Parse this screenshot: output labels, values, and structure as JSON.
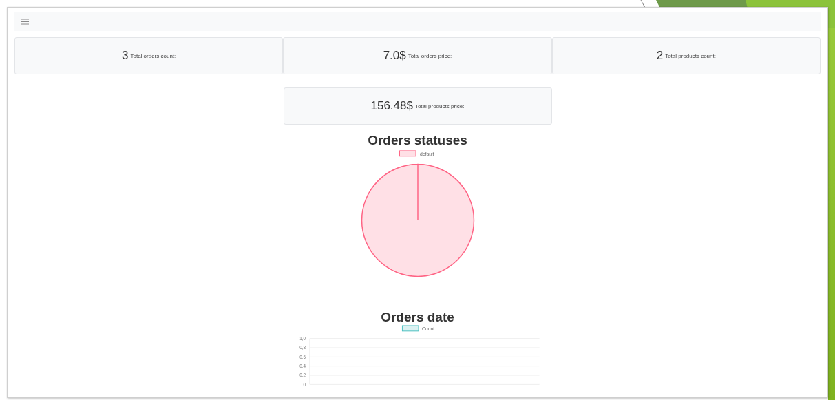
{
  "stats": [
    {
      "value": "3",
      "label": "Total orders count:"
    },
    {
      "value": "7.0$",
      "label": "Total orders price:"
    },
    {
      "value": "2",
      "label": "Total products count:"
    },
    {
      "value": "156.48$",
      "label": "Total products price:"
    }
  ],
  "orders_statuses": {
    "title": "Orders statuses",
    "chart_data": {
      "type": "pie",
      "categories": [
        "default"
      ],
      "values": [
        100
      ]
    }
  },
  "orders_date": {
    "title": "Orders date",
    "chart_data": {
      "type": "bar",
      "series": [
        {
          "name": "Count",
          "color": "#4bc0c0"
        }
      ],
      "grid": true,
      "ylim": [
        0,
        1
      ],
      "yticks": [
        {
          "value": 0,
          "label": "0"
        },
        {
          "value": 0.2,
          "label": "0,2"
        },
        {
          "value": 0.4,
          "label": "0,4"
        },
        {
          "value": 0.6,
          "label": "0,6"
        },
        {
          "value": 0.8,
          "label": "0,8"
        },
        {
          "value": 1,
          "label": "1,0"
        }
      ]
    }
  }
}
